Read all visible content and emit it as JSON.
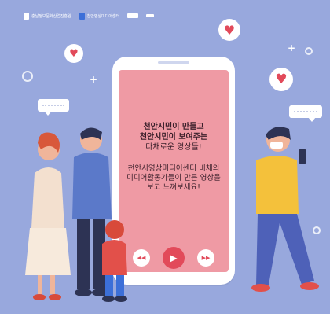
{
  "logos": {
    "org1": "충남정보문화산업진흥원",
    "org2": "천안영상미디어센터",
    "org3": "",
    "org4": ""
  },
  "phone": {
    "headline_line1": "천안시민이 만들고",
    "headline_line2": "천안시민이 보여주는",
    "subline": "다채로운 영상들!",
    "body_line1": "천안시영상미디어센터 비채의",
    "body_line2": "미디어활동가들이 만든 영상을",
    "body_line3": "보고 느껴보세요!"
  },
  "controls": {
    "rewind": "◀◀",
    "play": "▶",
    "forward": "▶▶"
  },
  "hearts": {
    "glyph": "♥"
  },
  "colors": {
    "background": "#98a8dd",
    "screen": "#ef9aa4",
    "accent": "#e24a5a"
  },
  "icons": [
    "heart-icon",
    "rewind-icon",
    "play-icon",
    "fast-forward-icon",
    "speech-bubble-icon"
  ]
}
